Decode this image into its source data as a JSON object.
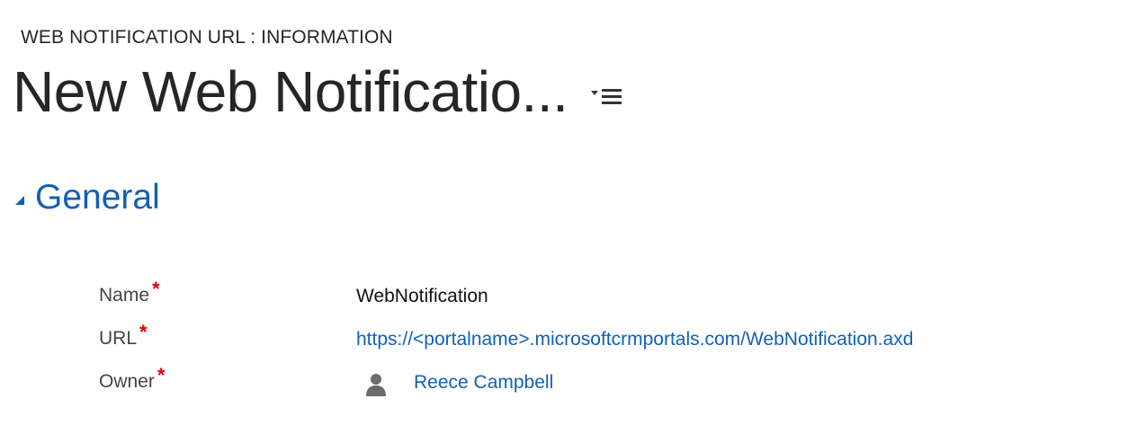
{
  "header": {
    "entity_label": "WEB NOTIFICATION URL : INFORMATION",
    "record_title": "New Web Notificatio...",
    "form_selector_icon": "form-selector-menu-icon"
  },
  "section": {
    "title": "General",
    "toggle_icon": "collapse-triangle-icon",
    "accent_color": "#1160b7"
  },
  "fields": {
    "name": {
      "label": "Name",
      "required_mark": "*",
      "value": "WebNotification"
    },
    "url": {
      "label": "URL",
      "required_mark": "*",
      "value": "https://<portalname>.microsoftcrmportals.com/WebNotification.axd"
    },
    "owner": {
      "label": "Owner",
      "required_mark": "*",
      "value": "Reece Campbell",
      "icon": "user-icon"
    }
  },
  "colors": {
    "required": "#e00000",
    "link": "#1160b7",
    "text": "#262626"
  }
}
